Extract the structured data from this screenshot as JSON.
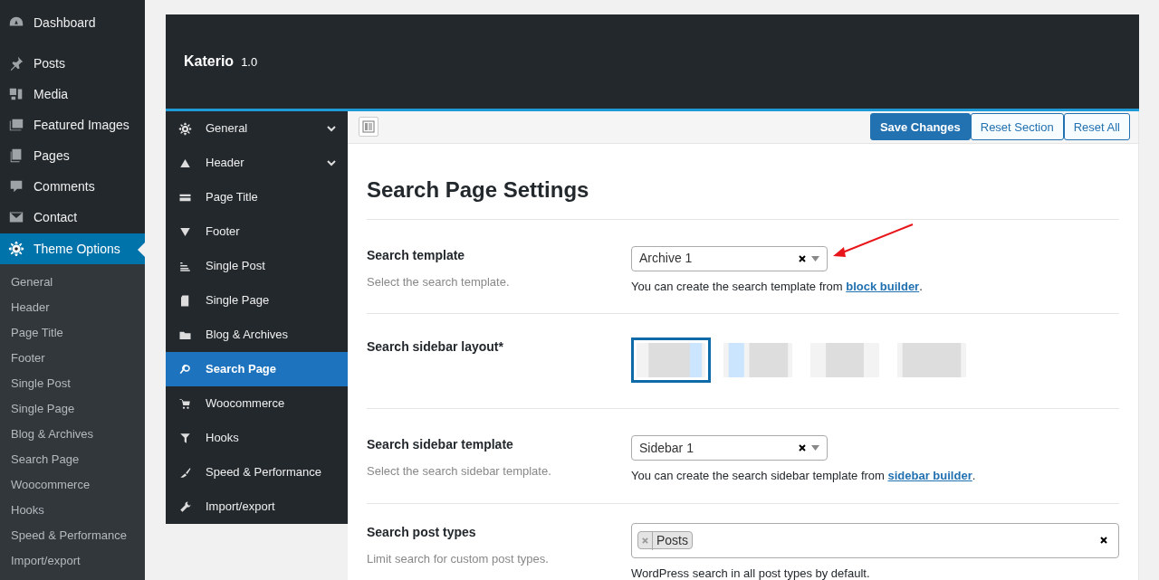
{
  "admin_menu": [
    {
      "label": "Dashboard",
      "selected": false
    },
    {
      "label": "Posts",
      "selected": false
    },
    {
      "label": "Media",
      "selected": false
    },
    {
      "label": "Featured Images",
      "selected": false
    },
    {
      "label": "Pages",
      "selected": false
    },
    {
      "label": "Comments",
      "selected": false
    },
    {
      "label": "Contact",
      "selected": false
    },
    {
      "label": "Theme Options",
      "selected": true
    }
  ],
  "admin_submenu": [
    {
      "label": "General"
    },
    {
      "label": "Header"
    },
    {
      "label": "Page Title"
    },
    {
      "label": "Footer"
    },
    {
      "label": "Single Post"
    },
    {
      "label": "Single Page"
    },
    {
      "label": "Blog & Archives"
    },
    {
      "label": "Search Page"
    },
    {
      "label": "Woocommerce"
    },
    {
      "label": "Hooks"
    },
    {
      "label": "Speed & Performance"
    },
    {
      "label": "Import/export"
    }
  ],
  "panel": {
    "title": "Katerio",
    "version": "1.0"
  },
  "options_nav": [
    {
      "label": "General",
      "has_children": true,
      "selected": false
    },
    {
      "label": "Header",
      "has_children": true,
      "selected": false
    },
    {
      "label": "Page Title",
      "has_children": false,
      "selected": false
    },
    {
      "label": "Footer",
      "has_children": false,
      "selected": false
    },
    {
      "label": "Single Post",
      "has_children": false,
      "selected": false
    },
    {
      "label": "Single Page",
      "has_children": false,
      "selected": false
    },
    {
      "label": "Blog & Archives",
      "has_children": false,
      "selected": false
    },
    {
      "label": "Search Page",
      "has_children": false,
      "selected": true
    },
    {
      "label": "Woocommerce",
      "has_children": false,
      "selected": false
    },
    {
      "label": "Hooks",
      "has_children": false,
      "selected": false
    },
    {
      "label": "Speed & Performance",
      "has_children": false,
      "selected": false
    },
    {
      "label": "Import/export",
      "has_children": false,
      "selected": false
    }
  ],
  "toolbar_buttons": [
    {
      "label": "Save Changes",
      "kind": "primary"
    },
    {
      "label": "Reset Section",
      "kind": "secondary"
    },
    {
      "label": "Reset All",
      "kind": "secondary"
    }
  ],
  "section_title": "Search Page Settings",
  "fields": [
    {
      "kind": "select",
      "label": "Search template",
      "description": "Select the search template.",
      "value": "Archive 1",
      "help_prefix": "You can create the search template from ",
      "link": "block builder",
      "help_suffix": "."
    },
    {
      "kind": "layout",
      "label": "Search sidebar layout*",
      "options": [
        {
          "kind": "right",
          "selected": true
        },
        {
          "kind": "left",
          "selected": false
        },
        {
          "kind": "center",
          "selected": false
        },
        {
          "kind": "wide",
          "selected": false
        }
      ]
    },
    {
      "kind": "select",
      "label": "Search sidebar template",
      "description": "Select the search sidebar template.",
      "value": "Sidebar 1",
      "help_prefix": "You can create the search sidebar template from ",
      "link": "sidebar builder",
      "help_suffix": "."
    },
    {
      "kind": "tags",
      "label": "Search post types",
      "description": "Limit search for custom post types.",
      "tags": [
        "Posts"
      ],
      "help": "WordPress search in all post types by default."
    }
  ]
}
